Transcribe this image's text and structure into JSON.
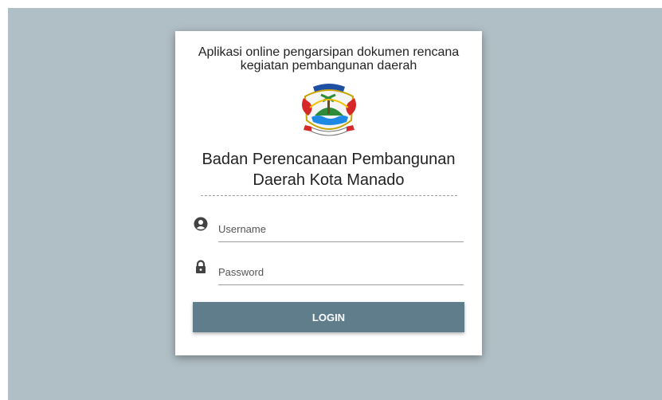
{
  "login_card": {
    "app_description": "Aplikasi online pengarsipan dokumen rencana kegiatan pembangunan daerah",
    "organization_title": "Badan Perencanaan Pembangunan Daerah Kota Manado",
    "username": {
      "placeholder": "Username",
      "value": "",
      "icon": "user-circle-icon"
    },
    "password": {
      "placeholder": "Password",
      "value": "",
      "icon": "lock-icon"
    },
    "login_label": "LOGIN"
  },
  "colors": {
    "page_background": "#b0bec5",
    "card_background": "#ffffff",
    "button_background": "#607d8b",
    "button_text": "#ffffff",
    "icon": "#424242"
  }
}
